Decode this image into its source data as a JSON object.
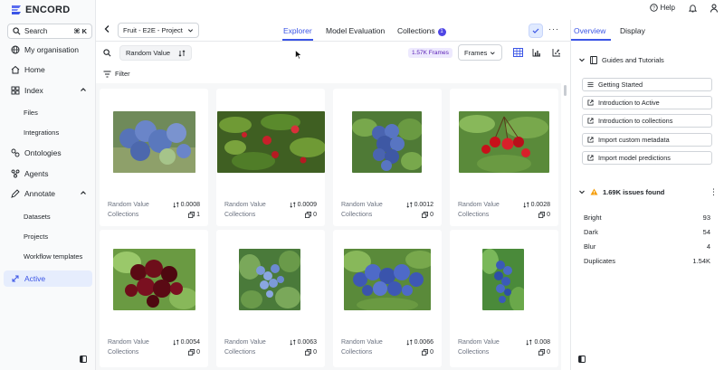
{
  "app": {
    "logo_text": "ENCORD"
  },
  "sidebar": {
    "search_label": "Search",
    "search_shortcut": "⌘ K",
    "items": [
      {
        "label": "My organisation",
        "icon": "globe-icon"
      },
      {
        "label": "Home",
        "icon": "home-icon"
      },
      {
        "label": "Index",
        "icon": "index-icon"
      },
      {
        "label": "Files"
      },
      {
        "label": "Integrations"
      },
      {
        "label": "Ontologies",
        "icon": "ontology-icon"
      },
      {
        "label": "Agents",
        "icon": "agents-icon"
      },
      {
        "label": "Annotate",
        "icon": "annotate-icon"
      },
      {
        "label": "Datasets"
      },
      {
        "label": "Projects"
      },
      {
        "label": "Workflow templates"
      },
      {
        "label": "Active",
        "icon": "active-icon"
      }
    ]
  },
  "topbar": {
    "help_label": "Help"
  },
  "subheader": {
    "project_name": "Fruit - E2E - Project I",
    "tabs": [
      {
        "label": "Explorer"
      },
      {
        "label": "Model Evaluation"
      },
      {
        "label": "Collections",
        "badge": "1"
      }
    ]
  },
  "toolbar": {
    "sort_label": "Random Value",
    "frames_count": "1.57K Frames",
    "frames_select": "Frames"
  },
  "filter_label": "Filter",
  "grid": {
    "row_labels": {
      "random": "Random Value",
      "collections": "Collections"
    },
    "cards": [
      {
        "image": "blueberries-cluster",
        "random_value": "0.0008",
        "collections": "1"
      },
      {
        "image": "red-berries-bush",
        "random_value": "0.0009",
        "collections": "0"
      },
      {
        "image": "blueberries-bunch",
        "random_value": "0.0012",
        "collections": "0"
      },
      {
        "image": "cherries-branch",
        "random_value": "0.0028",
        "collections": "0"
      },
      {
        "image": "dark-cherries",
        "random_value": "0.0054",
        "collections": "0"
      },
      {
        "image": "blueberry-bush",
        "random_value": "0.0063",
        "collections": "0"
      },
      {
        "image": "blueberries-branch",
        "random_value": "0.0066",
        "collections": "0"
      },
      {
        "image": "blueberries-hanging",
        "random_value": "0.008",
        "collections": "0"
      }
    ]
  },
  "right_panel": {
    "tabs": [
      {
        "label": "Overview"
      },
      {
        "label": "Display"
      }
    ],
    "guides_title": "Guides and Tutorials",
    "guides": [
      {
        "label": "Getting Started",
        "icon": "list-icon"
      },
      {
        "label": "Introduction to Active",
        "icon": "external-link-icon"
      },
      {
        "label": "Introduction to collections",
        "icon": "external-link-icon"
      },
      {
        "label": "Import custom metadata",
        "icon": "external-link-icon"
      },
      {
        "label": "Import model predictions",
        "icon": "external-link-icon"
      }
    ],
    "issues_title": "1.69K issues found",
    "issues": [
      {
        "label": "Bright",
        "value": "93"
      },
      {
        "label": "Dark",
        "value": "54"
      },
      {
        "label": "Blur",
        "value": "4"
      },
      {
        "label": "Duplicates",
        "value": "1.54K"
      }
    ]
  },
  "colors": {
    "accent": "#3b55e6",
    "badge_bg": "#ede9fe",
    "warning": "#f59e0b"
  }
}
